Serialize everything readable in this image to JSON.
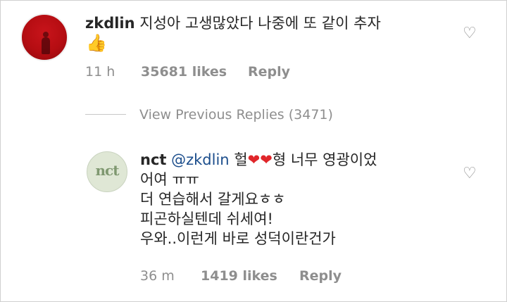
{
  "comment": {
    "username": "zkdlin",
    "text": "지성아 고생많았다 나중에 또 같이 추자",
    "emoji": "👍",
    "time": "11 h",
    "likes": "35681 likes",
    "reply_label": "Reply",
    "like_icon": "heart-outline-icon"
  },
  "view_previous": {
    "label": "View Previous Replies (3471)"
  },
  "reply": {
    "username": "nct",
    "mention": "@zkdlin",
    "line1_prefix": "헐",
    "heart1": "❤",
    "heart2": "❤",
    "line1_suffix": "형 너무 영광이었",
    "line2": "어여 ㅠㅠ",
    "line3": "더 연습해서 갈게요ㅎㅎ",
    "line4": "피곤하실텐데 쉬세여!",
    "line5": "우와..이런게 바로 성덕이란건가",
    "avatar_text": "nct",
    "time": "36 m",
    "likes": "1419 likes",
    "reply_label": "Reply",
    "like_icon": "heart-outline-icon"
  },
  "colors": {
    "mention": "#1c4e8c",
    "meta": "#8e8e8e",
    "red_heart": "#e0262a"
  }
}
